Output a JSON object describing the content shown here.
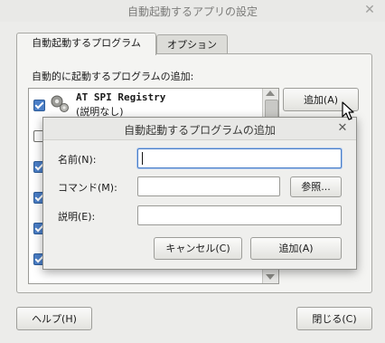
{
  "main_window": {
    "title": "自動起動するアプリの設定",
    "tabs": [
      "自動起動するプログラム",
      "オプション"
    ],
    "list_heading": "自動的に起動するプログラムの追加:",
    "items": [
      {
        "name": "AT SPI Registry",
        "description": "(説明なし)",
        "checked": true
      },
      {
        "name": "",
        "description": "",
        "checked": false
      },
      {
        "name": "",
        "description": "",
        "checked": true
      },
      {
        "name": "",
        "description": "",
        "checked": true
      },
      {
        "name": "",
        "description": "",
        "checked": true
      },
      {
        "name": "",
        "description": "",
        "checked": true
      }
    ],
    "add_button": "追加(A)",
    "help_button": "ヘルプ(H)",
    "close_button": "閉じる(C)"
  },
  "add_dialog": {
    "title": "自動起動するプログラムの追加",
    "name_label": "名前(N):",
    "name_value": "",
    "command_label": "コマンド(M):",
    "command_value": "",
    "browse_button": "参照...",
    "comment_label": "説明(E):",
    "comment_value": "",
    "cancel_button": "キャンセル(C)",
    "add_button": "追加(A)"
  },
  "icons": {
    "close": "close-icon",
    "program": "gears-icon",
    "cursor": "mouse-pointer-icon"
  },
  "colors": {
    "selection_accent": "#4a7ec7"
  }
}
